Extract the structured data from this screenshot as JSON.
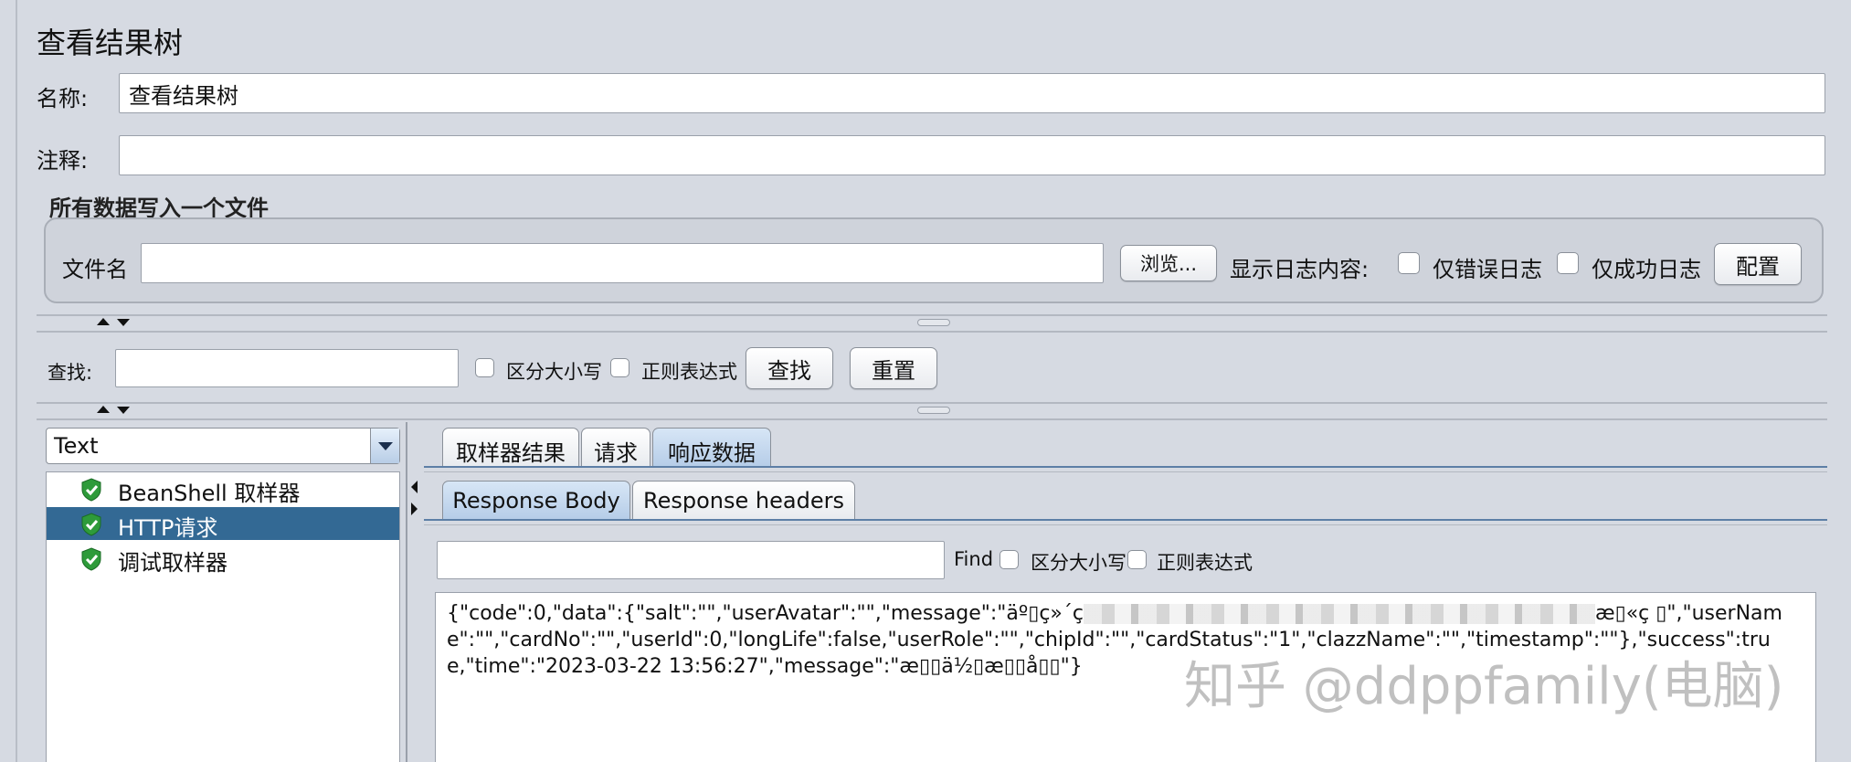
{
  "panel": {
    "title": "查看结果树",
    "name_label": "名称:",
    "name_value": "查看结果树",
    "comment_label": "注释:",
    "comment_value": ""
  },
  "file_group": {
    "title": "所有数据写入一个文件",
    "filename_label": "文件名",
    "filename_value": "",
    "browse_label": "浏览...",
    "log_content_label": "显示日志内容:",
    "errors_only_label": "仅错误日志",
    "success_only_label": "仅成功日志",
    "configure_label": "配置"
  },
  "search": {
    "label": "查找:",
    "value": "",
    "case_sensitive_label": "区分大小写",
    "regex_label": "正则表达式",
    "find_label": "查找",
    "reset_label": "重置"
  },
  "renderer": {
    "selected": "Text"
  },
  "tree": {
    "items": [
      {
        "label": "BeanShell 取样器",
        "status": "success"
      },
      {
        "label": "HTTP请求",
        "status": "success",
        "selected": true
      },
      {
        "label": "调试取样器",
        "status": "success"
      }
    ]
  },
  "result_tabs": {
    "tabs": [
      "取样器结果",
      "请求",
      "响应数据"
    ],
    "active": "响应数据"
  },
  "response_tabs": {
    "tabs": [
      "Response Body",
      "Response headers"
    ],
    "active": "Response Body"
  },
  "body_search": {
    "value": "",
    "find_label": "Find",
    "case_sensitive_label": "区分大小写",
    "regex_label": "正则表达式"
  },
  "response": {
    "text_before": "{\"code\":0,\"data\":{\"salt\":\"\",\"userAvatar\":\"\",\"message\":\"äº▯ç»´ç",
    "text_after": "æ▯«ç ▯\",\"userName\":\"\",\"cardNo\":\"\",\"userId\":0,\"longLife\":false,\"userRole\":\"\",\"chipId\":\"\",\"cardStatus\":\"1\",\"clazzName\":\"\",\"timestamp\":\"\"},\"success\":true,\"time\":\"2023-03-22 13:56:27\",\"message\":\"æ▯▯ä½▯æ▯▯å▯▯\"}"
  },
  "watermark": "知乎 @ddppfamily(电脑)",
  "colors": {
    "background": "#d6dae2",
    "selection": "#336994",
    "success_icon": "#2e9b3a"
  }
}
